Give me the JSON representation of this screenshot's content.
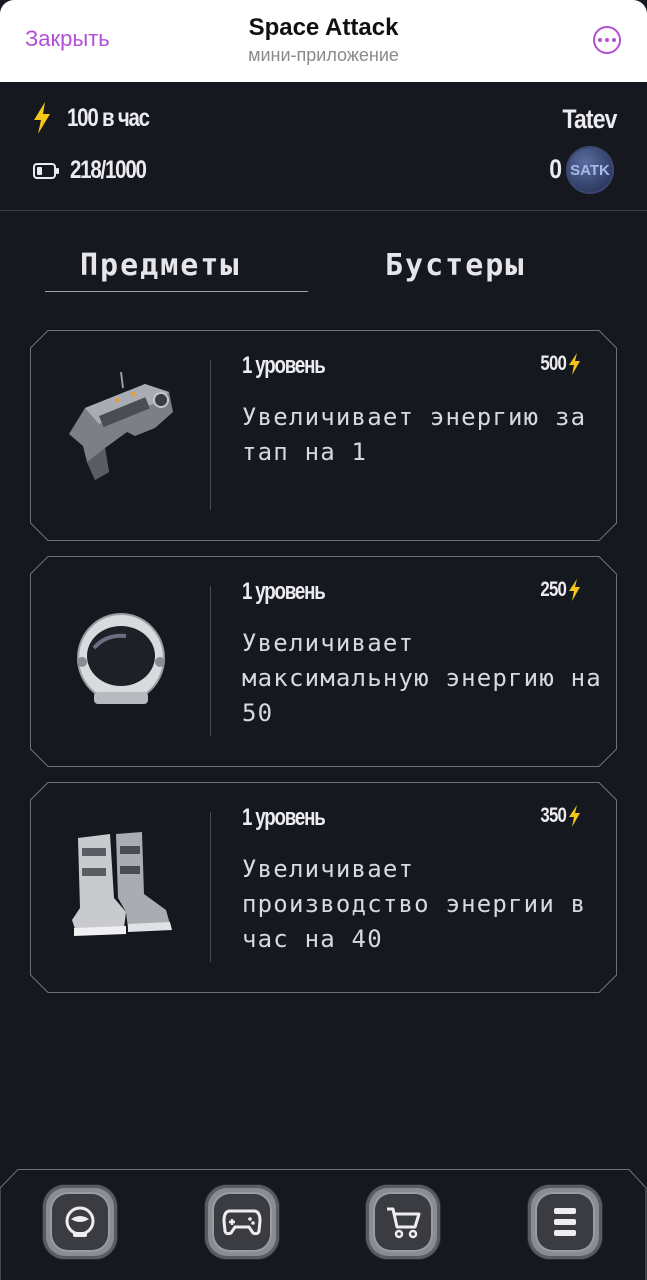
{
  "telegram": {
    "close_label": "Закрыть",
    "title": "Space Attack",
    "subtitle": "мини-приложение",
    "more_icon": "more-icon"
  },
  "stats": {
    "energy_rate": "100 в час",
    "energy_capacity": "218/1000",
    "username": "Tatev",
    "coins": "0",
    "coin_label": "SATK"
  },
  "tabs": [
    {
      "label": "Предметы",
      "active": true
    },
    {
      "label": "Бустеры",
      "active": false
    }
  ],
  "items": [
    {
      "level": "1 уровень",
      "price": "500",
      "description": "Увеличивает энергию за тап на 1",
      "icon": "blaster-icon"
    },
    {
      "level": "1 уровень",
      "price": "250",
      "description": "Увеличивает максимальную энергию на 50",
      "icon": "helmet-icon"
    },
    {
      "level": "1 уровень",
      "price": "350",
      "description": "Увеличивает производство энергии в час на 40",
      "icon": "boots-icon"
    }
  ],
  "nav": [
    {
      "icon": "astronaut-icon"
    },
    {
      "icon": "gamepad-icon"
    },
    {
      "icon": "cart-icon"
    },
    {
      "icon": "menu-icon"
    }
  ],
  "colors": {
    "background": "#161820",
    "accent": "#b14fd6",
    "bolt": "#f5c518",
    "card_border": "#6e717b"
  }
}
